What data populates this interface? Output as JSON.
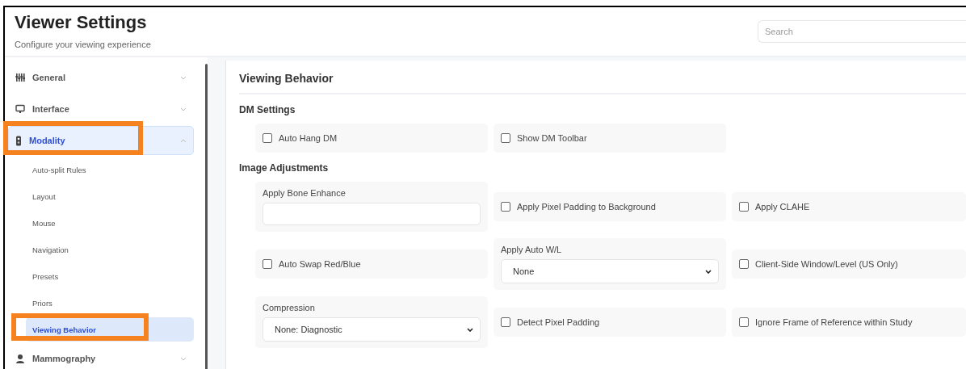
{
  "header": {
    "title": "Viewer Settings",
    "subtitle": "Configure your viewing experience"
  },
  "search": {
    "placeholder": "Search"
  },
  "sidebar": {
    "items": [
      {
        "label": "General",
        "expanded": false,
        "selected": false,
        "highlighted": false
      },
      {
        "label": "Interface",
        "expanded": false,
        "selected": false,
        "highlighted": false
      },
      {
        "label": "Modality",
        "expanded": true,
        "selected": true,
        "highlighted": true,
        "children": [
          {
            "label": "Auto-split Rules",
            "selected": false,
            "highlighted": false
          },
          {
            "label": "Layout",
            "selected": false,
            "highlighted": false
          },
          {
            "label": "Mouse",
            "selected": false,
            "highlighted": false
          },
          {
            "label": "Navigation",
            "selected": false,
            "highlighted": false
          },
          {
            "label": "Presets",
            "selected": false,
            "highlighted": false
          },
          {
            "label": "Priors",
            "selected": false,
            "highlighted": false
          },
          {
            "label": "Viewing Behavior",
            "selected": true,
            "highlighted": true
          }
        ]
      },
      {
        "label": "Mammography",
        "expanded": false,
        "selected": false,
        "highlighted": false
      }
    ]
  },
  "panel": {
    "title": "Viewing Behavior",
    "sections": [
      {
        "title": "DM Settings",
        "fields": [
          {
            "kind": "checkbox",
            "label": "Auto Hang DM",
            "checked": false
          },
          {
            "kind": "checkbox",
            "label": "Show DM Toolbar",
            "checked": false
          }
        ]
      },
      {
        "title": "Image Adjustments",
        "fields": [
          {
            "kind": "input",
            "label": "Apply Bone Enhance"
          },
          {
            "kind": "checkbox",
            "label": "Apply Pixel Padding to Background",
            "checked": false
          },
          {
            "kind": "checkbox",
            "label": "Apply CLAHE",
            "checked": false
          },
          {
            "kind": "checkbox",
            "label": "Auto Swap Red/Blue",
            "checked": false
          },
          {
            "kind": "select",
            "label": "Apply Auto W/L",
            "value": "None"
          },
          {
            "kind": "checkbox",
            "label": "Client-Side Window/Level (US Only)",
            "checked": false
          },
          {
            "kind": "select",
            "label": "Compression",
            "value": "None: Diagnostic"
          },
          {
            "kind": "checkbox",
            "label": "Detect Pixel Padding",
            "checked": false
          },
          {
            "kind": "checkbox",
            "label": "Ignore Frame of Reference within Study",
            "checked": false
          }
        ]
      }
    ]
  }
}
